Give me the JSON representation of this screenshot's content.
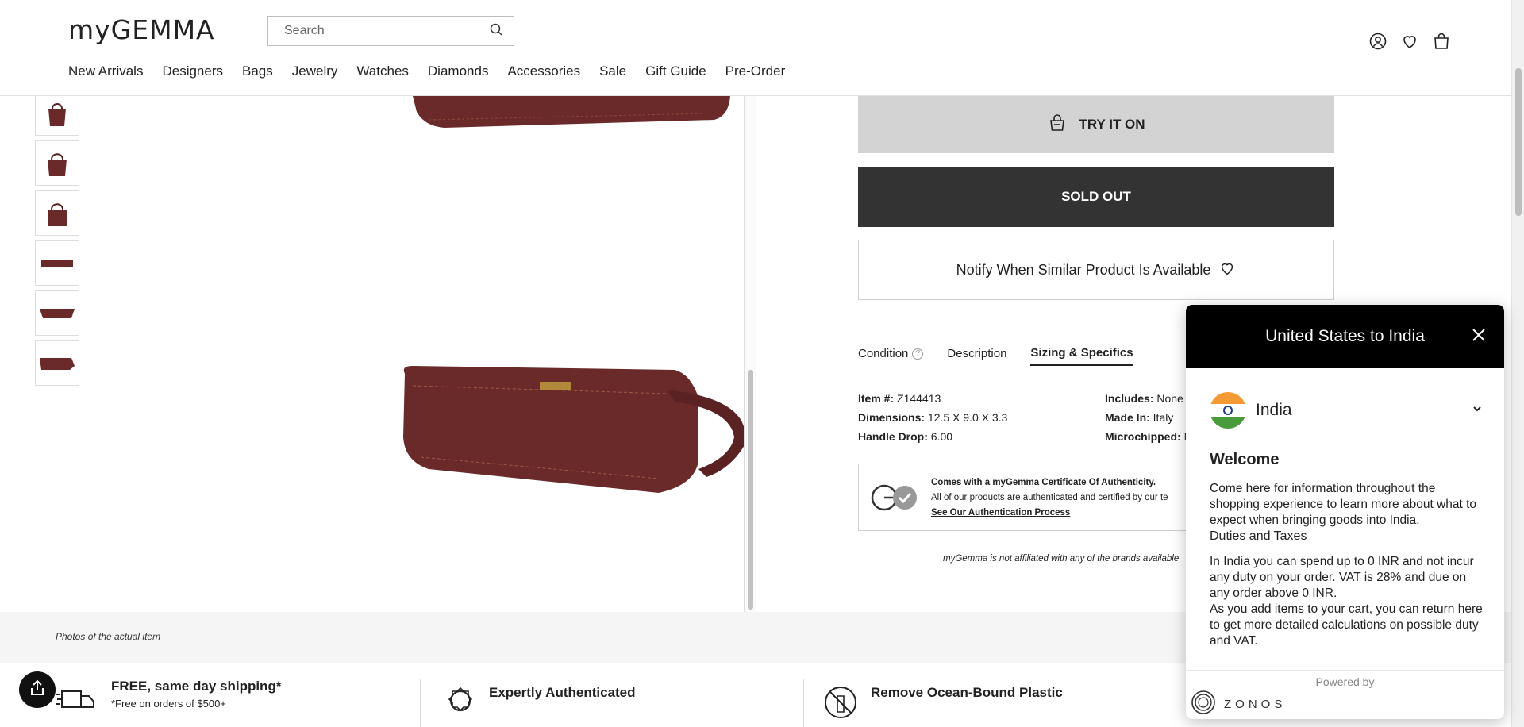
{
  "header": {
    "logo": "myGEMMA",
    "search_placeholder": "Search",
    "nav": [
      "New Arrivals",
      "Designers",
      "Bags",
      "Jewelry",
      "Watches",
      "Diamonds",
      "Accessories",
      "Sale",
      "Gift Guide",
      "Pre-Order"
    ],
    "icons": [
      "account-icon",
      "wishlist-heart-icon",
      "shopping-bag-icon"
    ]
  },
  "gallery": {
    "caption": "Photos of the actual item",
    "thumbnail_count": 6,
    "product_color": "#6b2a2a"
  },
  "product": {
    "try_on_label": "TRY IT ON",
    "sold_out_label": "SOLD OUT",
    "notify_label": "Notify When Similar Product Is Available",
    "tabs": [
      "Condition",
      "Description",
      "Sizing & Specifics"
    ],
    "active_tab": "Sizing & Specifics",
    "specs_left": [
      {
        "label": "Item #:",
        "value": "Z144413"
      },
      {
        "label": "Dimensions:",
        "value": "12.5 X 9.0 X 3.3"
      },
      {
        "label": "Handle Drop:",
        "value": "6.00"
      }
    ],
    "specs_right": [
      {
        "label": "Includes:",
        "value": "None"
      },
      {
        "label": "Made In:",
        "value": "Italy"
      },
      {
        "label": "Microchipped:",
        "value": "N"
      }
    ],
    "auth_title": "Comes with a myGemma Certificate Of Authenticity.",
    "auth_text": "All of our products are authenticated and certified by our te",
    "auth_link": "See Our Authentication Process",
    "disclaimer": "myGemma is not affiliated with any of the brands available"
  },
  "features": [
    {
      "title": "FREE, same day shipping*",
      "sub": "*Free on orders of $500+"
    },
    {
      "title": "Expertly Authenticated",
      "sub": ""
    },
    {
      "title": "Remove Ocean-Bound Plastic",
      "sub": ""
    }
  ],
  "zonos_modal": {
    "title": "United States to India",
    "country": "India",
    "welcome": "Welcome",
    "intro": "Come here for information throughout the shopping experience to learn more about what to expect when bringing goods into India.",
    "duties_heading": "Duties and Taxes",
    "duties_text": "In India you can spend up to 0 INR and not incur any duty on your order. VAT is 28% and due on any order above 0 INR.",
    "return_text": "As you add items to your cart, you can return here to get more detailed calculations on possible duty and VAT.",
    "powered_by": "Powered by",
    "brand": "ZONOS"
  }
}
